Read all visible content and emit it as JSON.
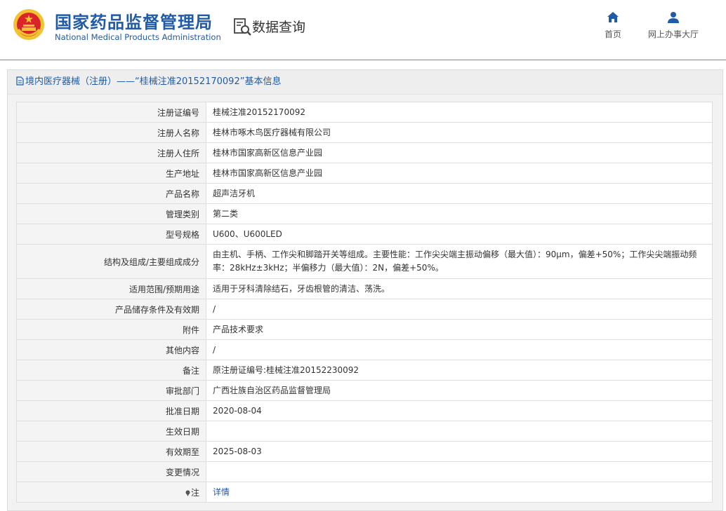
{
  "header": {
    "brand_cn": "国家药品监督管理局",
    "brand_en": "National Medical Products Administration",
    "query_label": "数据查询",
    "nav": [
      {
        "label": "首页",
        "icon": "home-icon"
      },
      {
        "label": "网上办事大厅",
        "icon": "user-icon"
      }
    ]
  },
  "panel": {
    "title": "境内医疗器械（注册）——“桂械注准20152170092”基本信息"
  },
  "rows": [
    {
      "label": "注册证编号",
      "value": "桂械注准20152170092"
    },
    {
      "label": "注册人名称",
      "value": "桂林市啄木鸟医疗器械有限公司"
    },
    {
      "label": "注册人住所",
      "value": "桂林市国家高新区信息产业园"
    },
    {
      "label": "生产地址",
      "value": "桂林市国家高新区信息产业园"
    },
    {
      "label": "产品名称",
      "value": "超声洁牙机"
    },
    {
      "label": "管理类别",
      "value": "第二类"
    },
    {
      "label": "型号规格",
      "value": "U600、U600LED"
    },
    {
      "label": "结构及组成/主要组成成分",
      "value": "由主机、手柄、工作尖和脚踏开关等组成。主要性能：工作尖尖端主振动偏移（最大值）：90μm，偏差+50%；工作尖尖端振动频率：28kHz±3kHz；半偏移力（最大值）：2N，偏差+50%。"
    },
    {
      "label": "适用范围/预期用途",
      "value": "适用于牙科清除结石，牙齿根管的清洁、荡洗。"
    },
    {
      "label": "产品储存条件及有效期",
      "value": "/"
    },
    {
      "label": "附件",
      "value": "产品技术要求"
    },
    {
      "label": "其他内容",
      "value": "/"
    },
    {
      "label": "备注",
      "value": "原注册证编号:桂械注准20152230092"
    },
    {
      "label": "审批部门",
      "value": "广西壮族自治区药品监督管理局"
    },
    {
      "label": "批准日期",
      "value": "2020-08-04"
    },
    {
      "label": "生效日期",
      "value": ""
    },
    {
      "label": "有效期至",
      "value": "2025-08-03"
    },
    {
      "label": "变更情况",
      "value": ""
    }
  ],
  "note": {
    "label": "注",
    "link": "详情"
  },
  "colors": {
    "brand": "#1f5ba9",
    "emblem_red": "#d9252a",
    "emblem_gold": "#f2c230"
  }
}
